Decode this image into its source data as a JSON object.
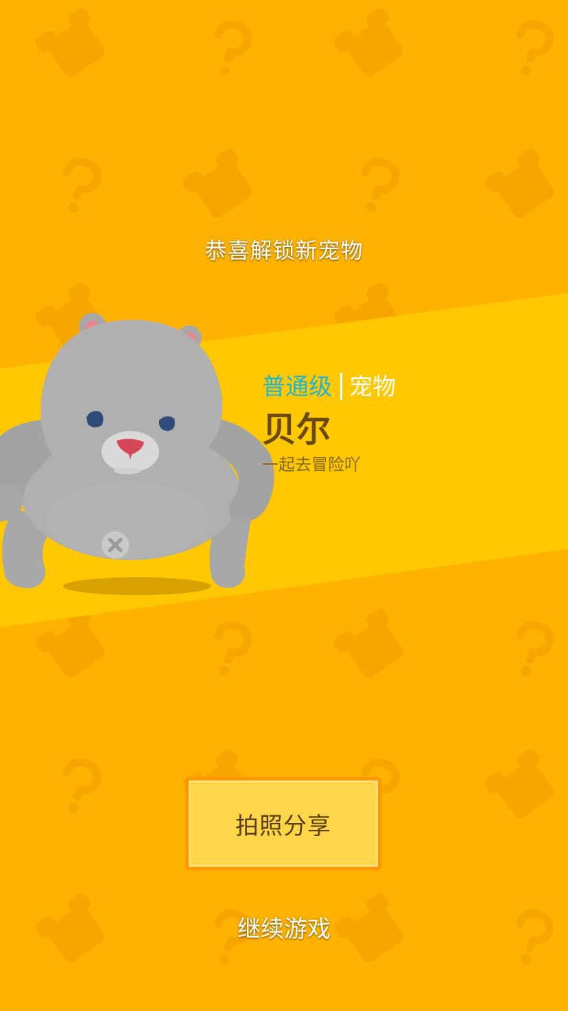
{
  "header": {
    "title": "恭喜解锁新宠物"
  },
  "pet": {
    "rank": "普通级",
    "type": "宠物",
    "name": "贝尔",
    "tagline": "一起去冒险吖"
  },
  "actions": {
    "share_label": "拍照分享",
    "continue_label": "继续游戏"
  },
  "icons": {
    "background_pattern": "mystery-box-question-mark-icon",
    "pet_illustration": "gray-bear-icon"
  },
  "colors": {
    "background": "#FFB300",
    "band": "#FFC800",
    "rank": "#1FB6D3",
    "name": "#6B4A00",
    "button_fill": "#FFD54A",
    "button_border": "#FF9800"
  }
}
